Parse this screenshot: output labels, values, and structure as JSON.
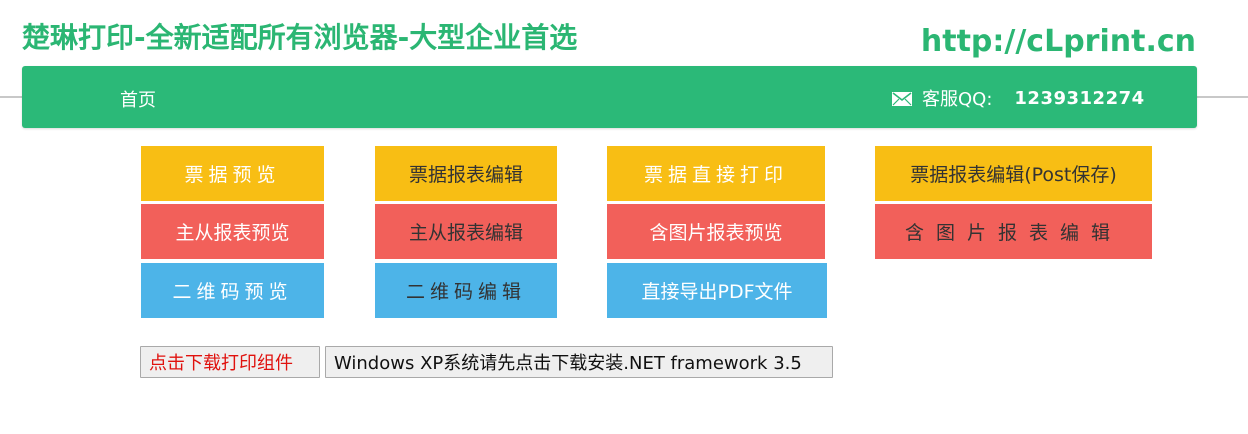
{
  "header": {
    "title": "楚琳打印-全新适配所有浏览器-大型企业首选",
    "url": "http://cLprint.cn"
  },
  "nav": {
    "home": "首页",
    "contact_icon": "mail-icon",
    "contact_label": "客服QQ:",
    "contact_qq": "1239312274"
  },
  "colors": {
    "brand_green": "#2bb978",
    "yellow": "#f8be14",
    "red": "#f2605a",
    "blue": "#4db4e8"
  },
  "tiles": {
    "col1": [
      "票据预览",
      "主从报表预览",
      "二维码预览"
    ],
    "col2": [
      "票据报表编辑",
      "主从报表编辑",
      "二维码编辑"
    ],
    "col3": [
      "票据直接打印",
      "含图片报表预览",
      "直接导出PDF文件"
    ],
    "col4": [
      "票据报表编辑(Post保存)",
      "含图片报表编辑"
    ]
  },
  "buttons": {
    "download": "点击下载打印组件",
    "dotnet": "Windows XP系统请先点击下载安装.NET framework 3.5"
  }
}
